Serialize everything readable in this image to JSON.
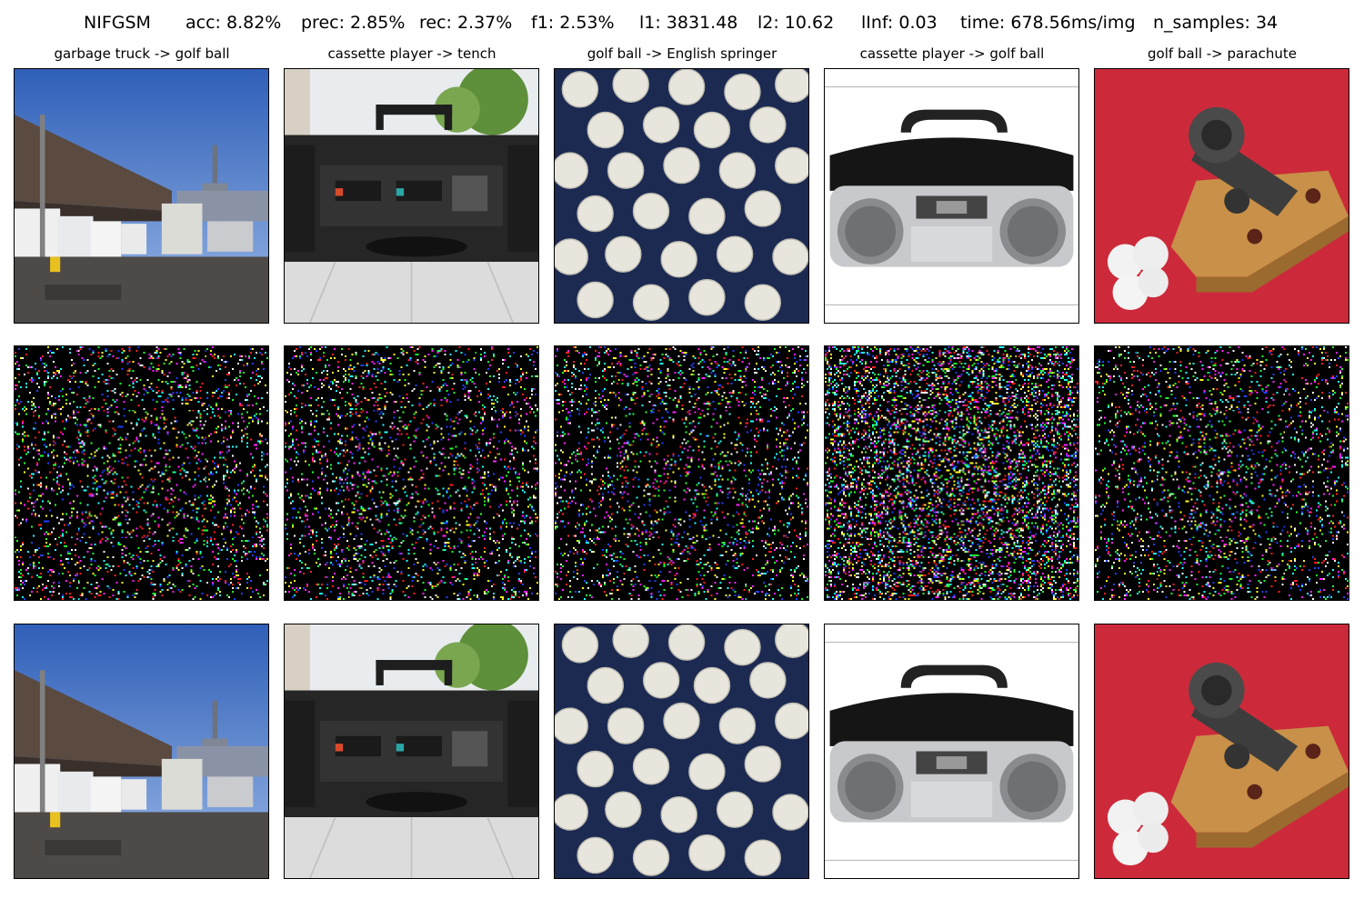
{
  "header": {
    "method": "NIFGSM",
    "acc": "acc: 8.82%",
    "prec": "prec: 2.85%",
    "rec": "rec: 2.37%",
    "f1": "f1: 2.53%",
    "l1": "l1: 3831.48",
    "l2": "l2: 10.62",
    "linf": "lInf: 0.03",
    "time": "time: 678.56ms/img",
    "n_samples": "n_samples: 34"
  },
  "columns": [
    {
      "title": "garbage truck -> golf ball",
      "scene": "street-with-garbage-trucks"
    },
    {
      "title": "cassette player -> tench",
      "scene": "boombox-with-turntable"
    },
    {
      "title": "golf ball -> English springer",
      "scene": "golf-balls-on-dark-blue"
    },
    {
      "title": "cassette player -> golf ball",
      "scene": "silver-cd-cassette-player"
    },
    {
      "title": "golf ball -> parachute",
      "scene": "toy-cannon-with-golf-balls"
    }
  ],
  "rows": [
    "original-image",
    "perturbation",
    "adversarial-image"
  ],
  "colors": {
    "sky": "#3f6fc4",
    "red_felt": "#cc2a3a",
    "navy": "#1c2a52",
    "noise_bg": "#000000"
  }
}
